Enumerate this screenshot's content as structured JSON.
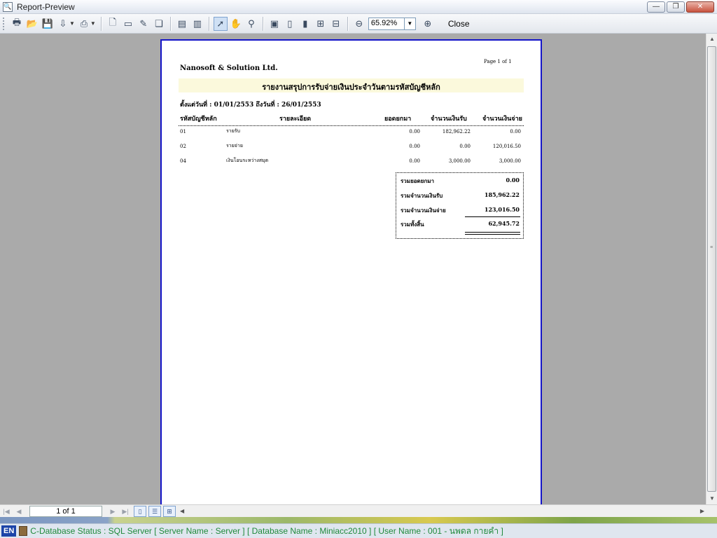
{
  "window": {
    "title": "Report-Preview",
    "minimize_glyph": "—",
    "maximize_glyph": "❐",
    "close_glyph": "✕"
  },
  "toolbar": {
    "zoom_value": "65.92%",
    "close_label": "Close",
    "icons": [
      "print-icon",
      "open-icon",
      "save-icon",
      "export-icon",
      "page-setup-icon",
      "new-page-icon",
      "blank-page-icon",
      "edit-page-icon",
      "copy-icon",
      "single-page-icon",
      "two-page-icon",
      "select-pointer-icon",
      "hand-pan-icon",
      "find-icon",
      "zoom-fit-icon",
      "zoom-width-icon",
      "zoom-page-icon",
      "multi-page-icon",
      "thumbnail-icon",
      "zoom-out-icon",
      "zoom-in-icon"
    ]
  },
  "report": {
    "company": "Nanosoft & Solution Ltd.",
    "page_label": "Page 1 of 1",
    "title": "รายงานสรุปการรับจ่ายเงินประจำวันตามรหัสบัญชีหลัก",
    "date_range": "ตั้งแต่วันที่ : 01/01/2553  ถึงวันที่ : 26/01/2553",
    "headers": {
      "code": "รหัสบัญชีหลัก",
      "detail": "รายละเอียด",
      "balance": "ยอดยกมา",
      "receive": "จำนวนเงินรับ",
      "pay": "จำนวนเงินจ่าย"
    },
    "rows": [
      {
        "code": "01",
        "detail": "รายรับ",
        "balance": "0.00",
        "receive": "182,962.22",
        "pay": "0.00"
      },
      {
        "code": "02",
        "detail": "รายจ่าย",
        "balance": "0.00",
        "receive": "0.00",
        "pay": "120,016.50"
      },
      {
        "code": "04",
        "detail": "เงินโอนระหว่างสมุด",
        "balance": "0.00",
        "receive": "3,000.00",
        "pay": "3,000.00"
      }
    ],
    "summary": {
      "balance_label": "รวมยอดยกมา",
      "balance_value": "0.00",
      "receive_label": "รวมจำนวนเงินรับ",
      "receive_value": "185,962.22",
      "pay_label": "รวมจำนวนเงินจ่าย",
      "pay_value": "123,016.50",
      "total_label": "รวมทั้งสิ้น",
      "total_value": "62,945.72"
    }
  },
  "navigation": {
    "page_indicator": "1 of 1"
  },
  "status": {
    "language": "EN",
    "text": "C-Database Status : SQL Server [ Server Name : Server ]  [ Database Name : Miniacc2010 ]  [ User Name : 001 - นพดล กายคำ ]"
  }
}
